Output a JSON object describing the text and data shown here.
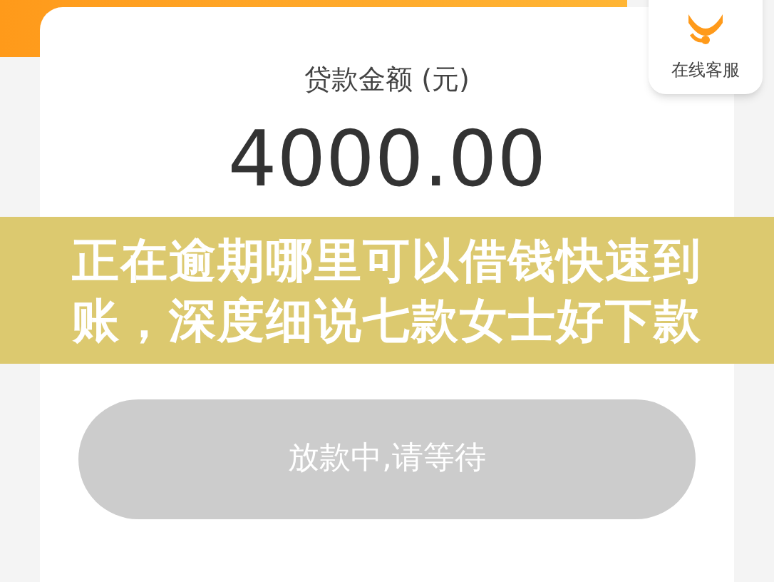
{
  "customer_service": {
    "label": "在线客服"
  },
  "loan": {
    "label": "贷款金额 (元)",
    "amount": "4000.00"
  },
  "banner": {
    "title": "正在逾期哪里可以借钱快速到账，深度细说七款女士好下款"
  },
  "action_button": {
    "label": "放款中,请等待",
    "disabled": true
  }
}
